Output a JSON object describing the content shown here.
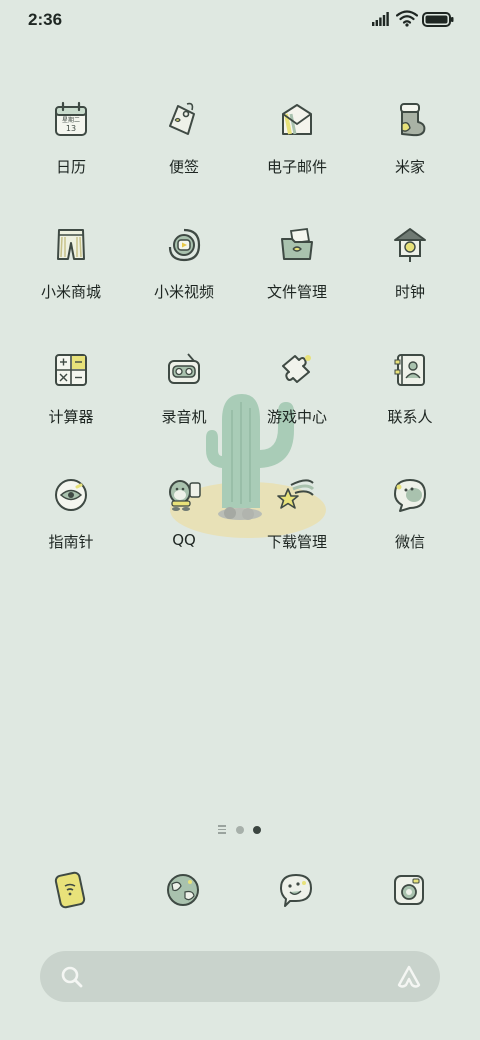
{
  "status_bar": {
    "time": "2:36"
  },
  "apps": [
    {
      "label": "日历",
      "icon": "calendar-icon",
      "icon_text": "星期二 13"
    },
    {
      "label": "便签",
      "icon": "notes-tag-icon"
    },
    {
      "label": "电子邮件",
      "icon": "email-icon"
    },
    {
      "label": "米家",
      "icon": "mijia-sock-icon"
    },
    {
      "label": "小米商城",
      "icon": "shorts-store-icon"
    },
    {
      "label": "小米视频",
      "icon": "video-icon"
    },
    {
      "label": "文件管理",
      "icon": "folder-icon"
    },
    {
      "label": "时钟",
      "icon": "clock-birdhouse-icon"
    },
    {
      "label": "计算器",
      "icon": "calculator-icon"
    },
    {
      "label": "录音机",
      "icon": "recorder-icon"
    },
    {
      "label": "游戏中心",
      "icon": "puzzle-icon"
    },
    {
      "label": "联系人",
      "icon": "contacts-icon"
    },
    {
      "label": "指南针",
      "icon": "compass-icon"
    },
    {
      "label": "QQ",
      "icon": "qq-icon"
    },
    {
      "label": "下载管理",
      "icon": "download-star-icon"
    },
    {
      "label": "微信",
      "icon": "wechat-icon"
    }
  ],
  "pager": {
    "pages": 2,
    "current": 2
  },
  "dock": [
    {
      "icon": "phone-icon"
    },
    {
      "icon": "browser-globe-icon"
    },
    {
      "icon": "messages-icon"
    },
    {
      "icon": "camera-icon"
    }
  ],
  "colors": {
    "background": "#dfe8e1",
    "accent_yellow": "#e8e27a",
    "icon_green": "#a9c2ae"
  }
}
